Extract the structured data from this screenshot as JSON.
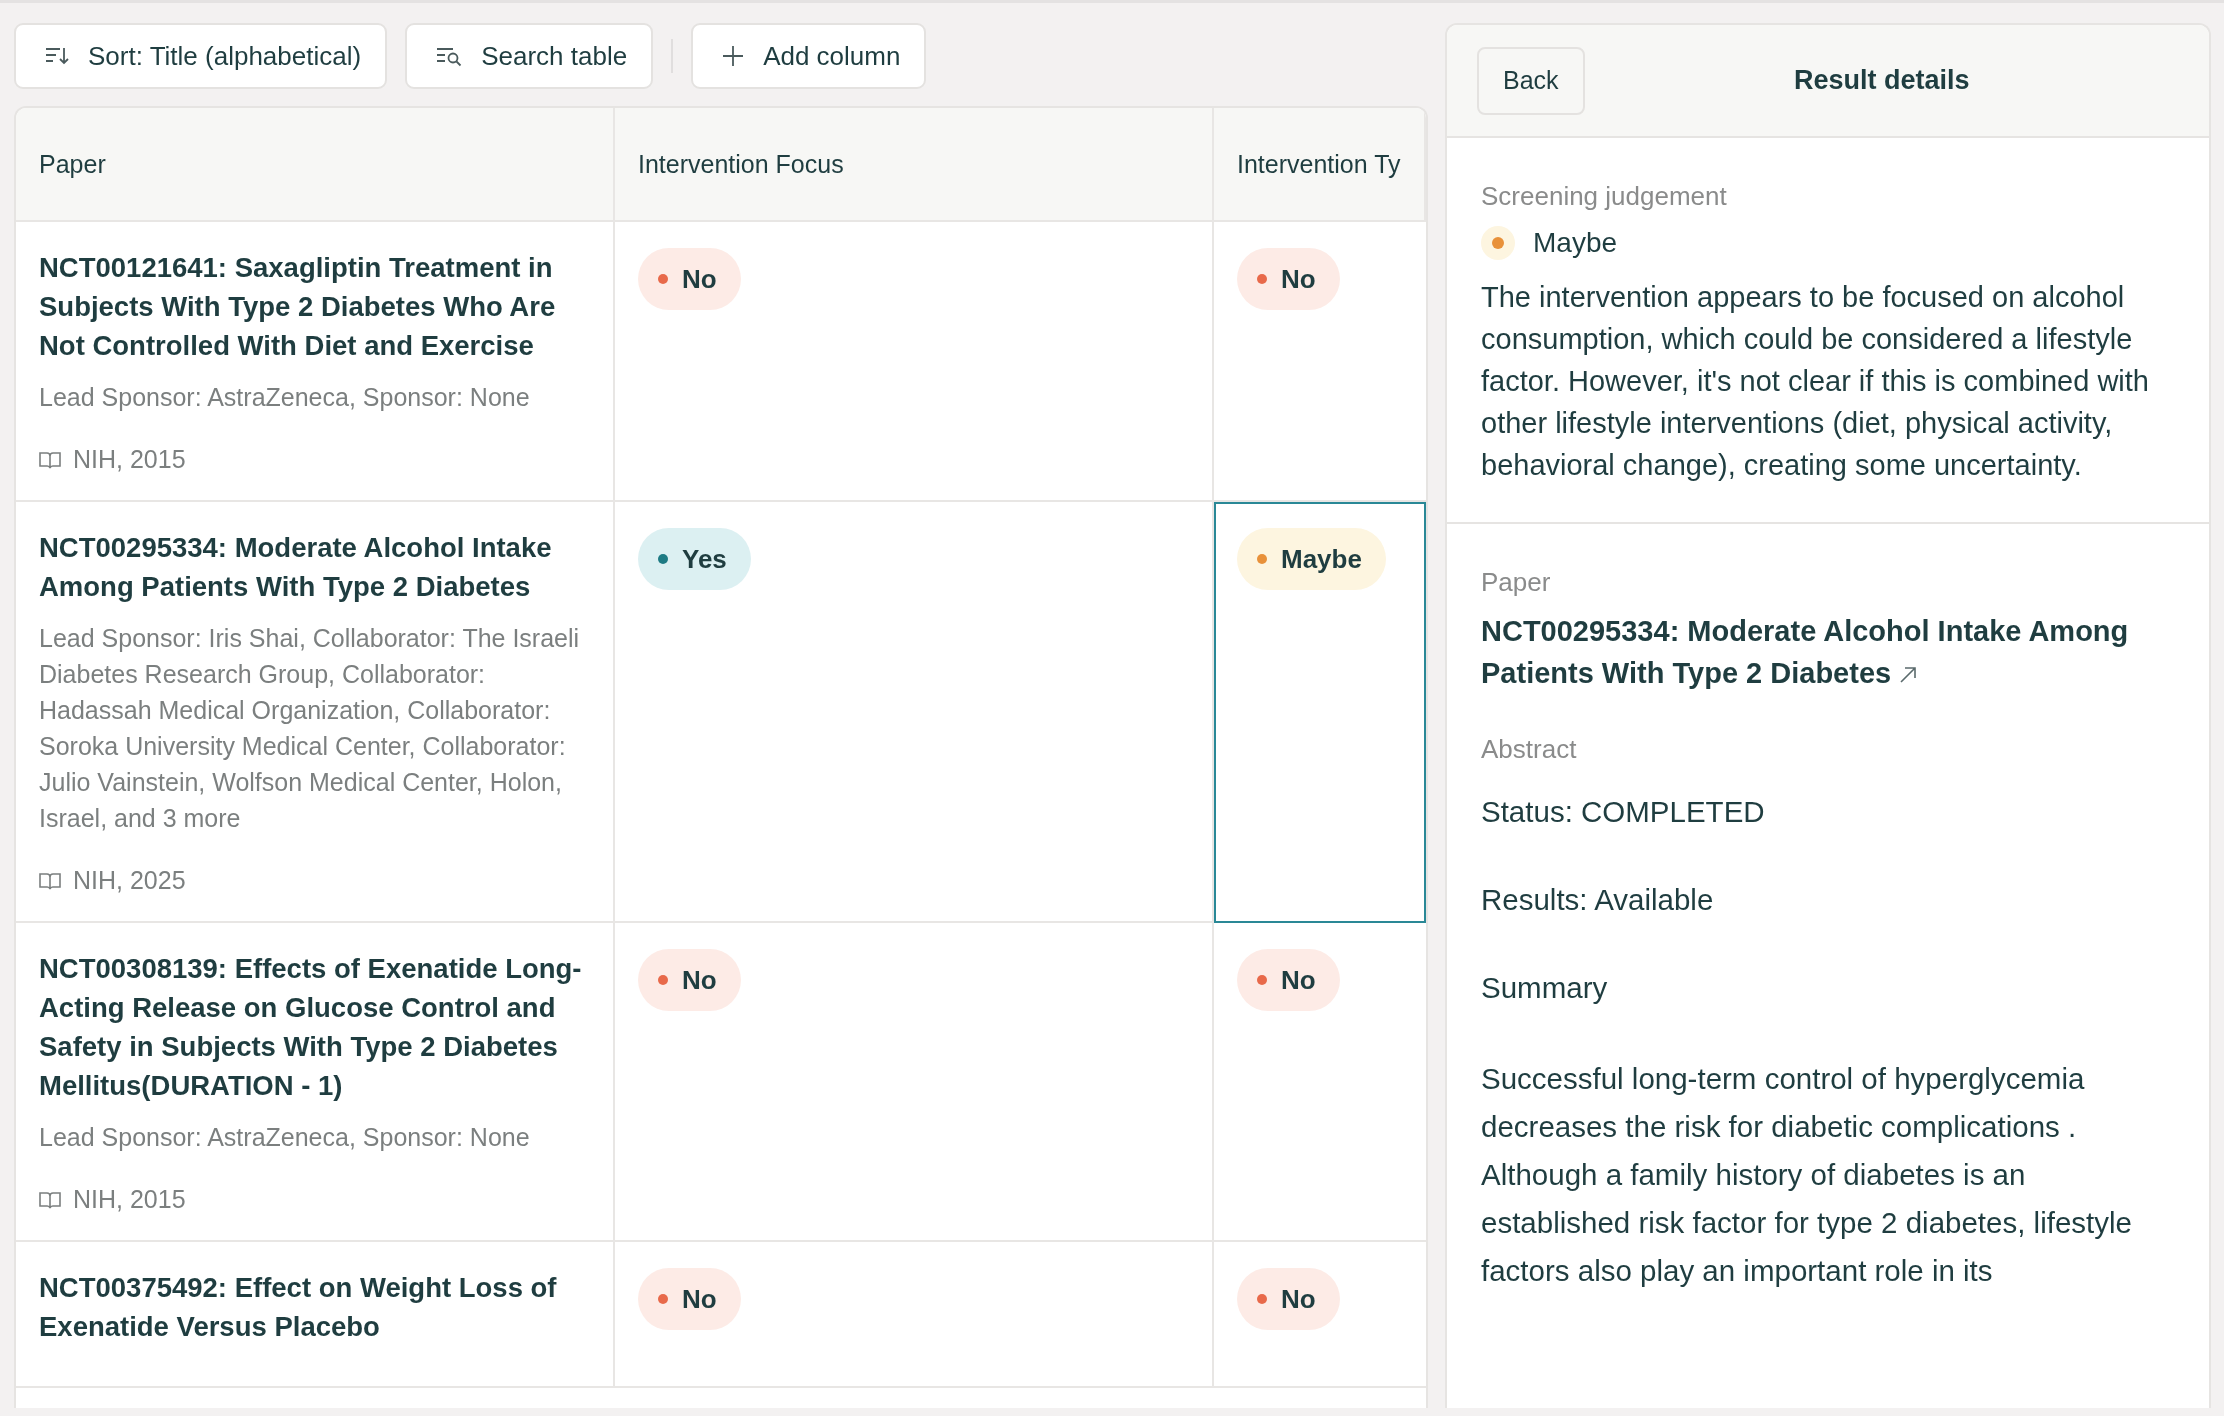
{
  "toolbar": [
    {
      "kind": "sort",
      "label": "Sort: Title (alphabetical)"
    },
    {
      "kind": "search",
      "label": "Search table"
    },
    {
      "kind": "add",
      "label": "Add column"
    }
  ],
  "table": {
    "columns": [
      "Paper",
      "Intervention Focus",
      "Intervention Ty"
    ],
    "rows": [
      {
        "cells": [
          {
            "title": "NCT00121641: Saxagliptin Treatment in Subjects With Type 2 Diabetes Who Are Not Controlled With Diet and Exercise",
            "sponsors": "Lead Sponsor: AstraZeneca, Sponsor: None",
            "source": "NIH, 2015"
          },
          {
            "label": "No",
            "kind": "no",
            "selected": false
          },
          {
            "label": "No",
            "kind": "no",
            "selected": false
          }
        ]
      },
      {
        "cells": [
          {
            "title": "NCT00295334: Moderate Alcohol Intake Among Patients With Type 2 Diabetes",
            "sponsors": "Lead Sponsor: Iris Shai, Collaborator: The Israeli Diabetes Research Group, Collaborator: Hadassah Medical Organization, Collaborator: Soroka University Medical Center, Collaborator: Julio Vainstein, Wolfson Medical Center, Holon, Israel, and 3 more",
            "source": "NIH, 2025"
          },
          {
            "label": "Yes",
            "kind": "yes",
            "selected": false
          },
          {
            "label": "Maybe",
            "kind": "maybe",
            "selected": true
          }
        ]
      },
      {
        "cells": [
          {
            "title": "NCT00308139: Effects of Exenatide Long-Acting Release on Glucose Control and Safety in Subjects With Type 2 Diabetes Mellitus(DURATION - 1)",
            "sponsors": "Lead Sponsor: AstraZeneca, Sponsor: None",
            "source": "NIH, 2015"
          },
          {
            "label": "No",
            "kind": "no",
            "selected": false
          },
          {
            "label": "No",
            "kind": "no",
            "selected": false
          }
        ]
      },
      {
        "cells": [
          {
            "title": "NCT00375492: Effect on Weight Loss of Exenatide Versus Placebo"
          },
          {
            "label": "No",
            "kind": "no",
            "selected": false
          },
          {
            "label": "No",
            "kind": "no",
            "selected": false
          }
        ]
      }
    ]
  },
  "details": {
    "back": "Back",
    "title": "Result details",
    "screening": {
      "label": "Screening judgement",
      "judgement": {
        "label": "Maybe",
        "kind": "maybe"
      },
      "reasoning": "The intervention appears to be focused on alcohol consumption, which could be considered a lifestyle factor. However, it's not clear if this is combined with other lifestyle interventions (diet, physical activity, behavioral change), creating some uncertainty."
    },
    "paper": {
      "label": "Paper",
      "title": "NCT00295334: Moderate Alcohol Intake Among Patients With Type 2 Diabetes",
      "abstract_label": "Abstract",
      "abstract": [
        "Status: COMPLETED",
        "Results: Available",
        "Summary",
        "Successful long-term control of hyperglycemia decreases the risk for diabetic complications . Although a family history of diabetes is an established risk factor for type 2 diabetes, lifestyle factors also play an important role in its"
      ]
    }
  }
}
